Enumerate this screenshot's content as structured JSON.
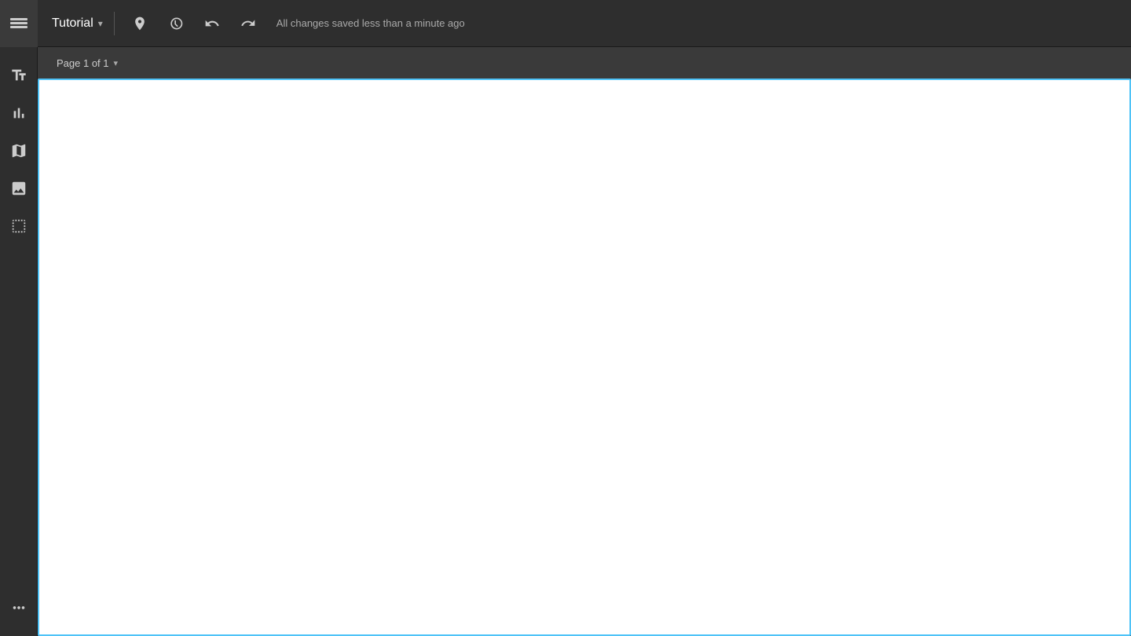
{
  "header": {
    "app_icon_label": "app-icon",
    "title": "Tutorial",
    "title_chevron": "▾",
    "save_status": "All changes saved less than a minute ago",
    "toolbar": {
      "pin_label": "pin",
      "clock_label": "clock",
      "undo_label": "undo",
      "redo_label": "redo"
    }
  },
  "sidebar": {
    "items": [
      {
        "icon": "text-icon",
        "label": "Text",
        "unicode": "Aa"
      },
      {
        "icon": "chart-icon",
        "label": "Chart"
      },
      {
        "icon": "map-icon",
        "label": "Map"
      },
      {
        "icon": "image-icon",
        "label": "Image"
      },
      {
        "icon": "data-icon",
        "label": "Data"
      },
      {
        "icon": "more-icon",
        "label": "More",
        "unicode": "···"
      }
    ]
  },
  "page_nav": {
    "label": "Page 1 of 1",
    "chevron": "▾"
  },
  "canvas": {
    "background_color": "#ffffff",
    "border_color": "#4fc3f7"
  }
}
